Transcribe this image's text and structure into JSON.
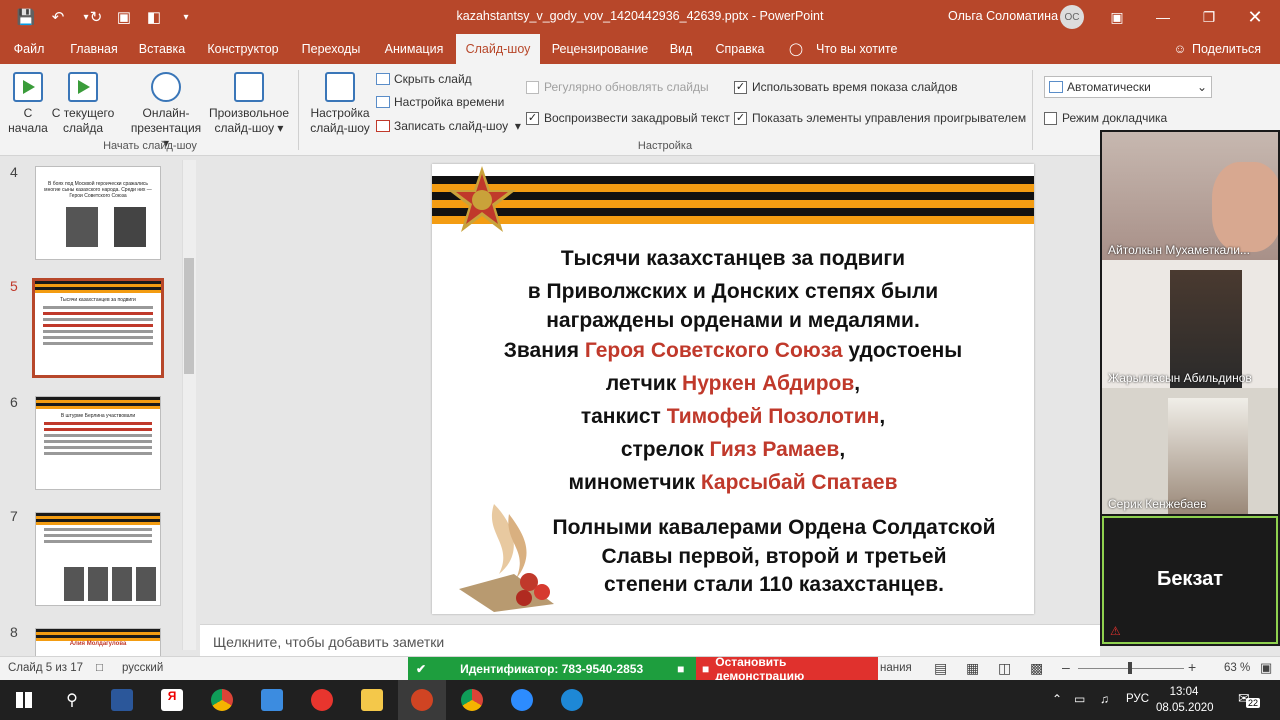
{
  "titlebar": {
    "document_title": "kazahstantsy_v_gody_vov_1420442936_42639.pptx  -  PowerPoint",
    "user_name": "Ольга Соломатина",
    "user_initials": "ОС"
  },
  "tabs": [
    "Файл",
    "Главная",
    "Вставка",
    "Конструктор",
    "Переходы",
    "Анимация",
    "Слайд-шоу",
    "Рецензирование",
    "Вид",
    "Справка"
  ],
  "tell_me": "Что вы хотите сделать?",
  "share_label": "Поделиться",
  "ribbon": {
    "start_group": {
      "label": "Начать слайд-шоу",
      "from_start": [
        "С",
        "начала"
      ],
      "from_current": [
        "С текущего",
        "слайда"
      ],
      "online": [
        "Онлайн-",
        "презентация"
      ],
      "custom": [
        "Произвольное",
        "слайд-шоу"
      ]
    },
    "setup_group": {
      "label": "Настройка",
      "setup": [
        "Настройка",
        "слайд-шоу"
      ],
      "hide_slide": "Скрыть слайд",
      "rehearse": "Настройка времени",
      "record": "Записать слайд-шоу",
      "keep_updated": "Регулярно обновлять слайды",
      "play_narrations": "Воспроизвести закадровый текст",
      "use_timings": "Использовать время показа слайдов",
      "show_controls": "Показать элементы управления проигрывателем"
    },
    "monitors": {
      "monitor_value": "Автоматически",
      "presenter_view": "Режим докладчика"
    }
  },
  "thumbnails": [
    {
      "num": "4",
      "text": "В боях под Москвой героически сражались многие сыны казахского народа. Среди них — Герои Советского Союза"
    },
    {
      "num": "5",
      "text": "Тысячи казахстанцев за подвиги"
    },
    {
      "num": "6",
      "text": "В штурме Берлина участвовали"
    },
    {
      "num": "7",
      "text": ""
    },
    {
      "num": "8",
      "text": "Алия Молдагулова"
    }
  ],
  "slide": {
    "line1": "Тысячи казахстанцев за подвиги",
    "line2": "в Приволжских и Донских степях были",
    "line3": "награждены орденами и медалями.",
    "line4a": "Звания ",
    "line4b": "Героя Советского Союза",
    "line4c": " удостоены",
    "line5a": "летчик ",
    "line5b": "Нуркен Абдиров",
    "line5c": ",",
    "line6a": "танкист ",
    "line6b": "Тимофей Позолотин",
    "line6c": ",",
    "line7a": "стрелок ",
    "line7b": "Гияз Рамаев",
    "line7c": ",",
    "line8a": "минометчик ",
    "line8b": "Карсыбай Спатаев",
    "line9": "Полными кавалерами Ордена Солдатской",
    "line10": "Славы первой, второй и  третьей",
    "line11": "степени стали 110 казахстанцев."
  },
  "notes_placeholder": "Щелкните, чтобы добавить заметки",
  "video": {
    "participants": [
      "Айтолкын Мухаметкали...",
      "Жарылгасын Абильдинов",
      "Серик Кенжебаев",
      "Бекзат"
    ]
  },
  "status": {
    "slide_counter": "Слайд 5 из 17",
    "language": "русский",
    "meeting_id": "Идентификатор: 783-9540-2853",
    "stop_share": "Остановить демонстрацию",
    "notes_partial": "нания",
    "zoom_level": "63 %"
  },
  "taskbar": {
    "lang": "РУС",
    "time": "13:04",
    "date": "08.05.2020",
    "notif_count": "22"
  }
}
